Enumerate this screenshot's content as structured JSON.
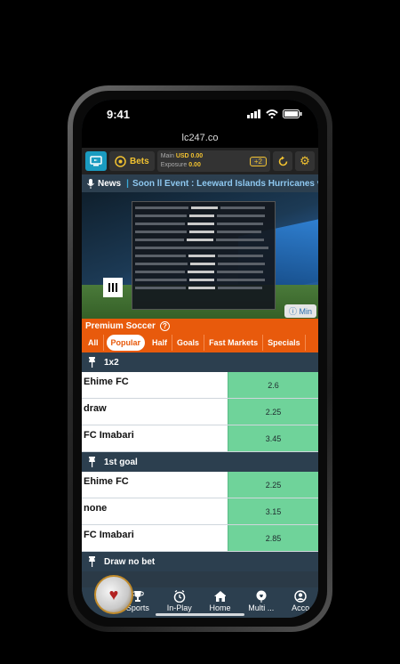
{
  "status": {
    "time": "9:41"
  },
  "browser": {
    "url": "lc247.co"
  },
  "topbar": {
    "bets_label": "Bets",
    "main_label": "Main",
    "main_value": "USD 0.00",
    "exposure_label": "Exposure",
    "exposure_value": "0.00",
    "plus_badge": "+2"
  },
  "news": {
    "label": "News",
    "ticker": "Soon ll Event : Leeward Islands Hurricanes v B"
  },
  "video": {
    "min_label": "Min"
  },
  "section": {
    "title": "Premium Soccer"
  },
  "filters": [
    "All",
    "Popular",
    "Half",
    "Goals",
    "Fast Markets",
    "Specials"
  ],
  "markets": [
    {
      "title": "1x2",
      "rows": [
        {
          "name": "Ehime FC",
          "odds": "2.6"
        },
        {
          "name": "draw",
          "odds": "2.25"
        },
        {
          "name": "FC Imabari",
          "odds": "3.45"
        }
      ]
    },
    {
      "title": "1st goal",
      "rows": [
        {
          "name": "Ehime FC",
          "odds": "2.25"
        },
        {
          "name": "none",
          "odds": "3.15"
        },
        {
          "name": "FC Imabari",
          "odds": "2.85"
        }
      ]
    },
    {
      "title": "Draw no bet",
      "rows": []
    }
  ],
  "bottomnav": [
    "Sports",
    "In-Play",
    "Home",
    "Multi ...",
    "Acco"
  ],
  "colors": {
    "accent": "#e85a0c",
    "odds": "#6fd39a",
    "gold": "#f2c230",
    "panel": "#2c3f4f"
  }
}
